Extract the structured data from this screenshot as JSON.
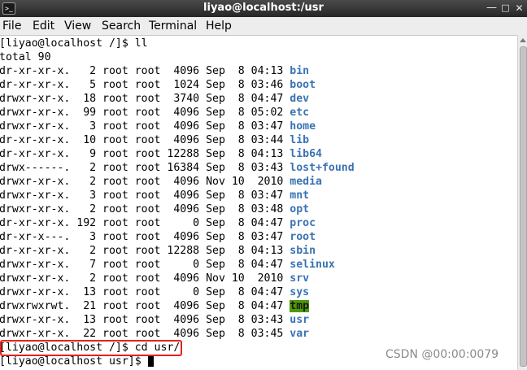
{
  "window": {
    "title": "liyao@localhost:/usr",
    "app_icon": "terminal-icon"
  },
  "menu": [
    "File",
    "Edit",
    "View",
    "Search",
    "Terminal",
    "Help"
  ],
  "terminal": {
    "prompt_root": "[liyao@localhost /]$ ",
    "command_1": "ll",
    "total": "total 90",
    "entries": [
      {
        "meta": "dr-xr-xr-x.   2 root root  4096 Sep  8 04:13 ",
        "name": "bin"
      },
      {
        "meta": "dr-xr-xr-x.   5 root root  1024 Sep  8 03:46 ",
        "name": "boot"
      },
      {
        "meta": "drwxr-xr-x.  18 root root  3740 Sep  8 04:47 ",
        "name": "dev"
      },
      {
        "meta": "drwxr-xr-x.  99 root root  4096 Sep  8 05:02 ",
        "name": "etc"
      },
      {
        "meta": "drwxr-xr-x.   3 root root  4096 Sep  8 03:47 ",
        "name": "home"
      },
      {
        "meta": "dr-xr-xr-x.  10 root root  4096 Sep  8 03:44 ",
        "name": "lib"
      },
      {
        "meta": "dr-xr-xr-x.   9 root root 12288 Sep  8 04:13 ",
        "name": "lib64"
      },
      {
        "meta": "drwx------.   2 root root 16384 Sep  8 03:43 ",
        "name": "lost+found"
      },
      {
        "meta": "drwxr-xr-x.   2 root root  4096 Nov 10  2010 ",
        "name": "media"
      },
      {
        "meta": "drwxr-xr-x.   3 root root  4096 Sep  8 03:47 ",
        "name": "mnt"
      },
      {
        "meta": "drwxr-xr-x.   2 root root  4096 Sep  8 03:48 ",
        "name": "opt"
      },
      {
        "meta": "dr-xr-xr-x. 192 root root     0 Sep  8 04:47 ",
        "name": "proc"
      },
      {
        "meta": "dr-xr-x---.   3 root root  4096 Sep  8 03:47 ",
        "name": "root"
      },
      {
        "meta": "dr-xr-xr-x.   2 root root 12288 Sep  8 04:13 ",
        "name": "sbin"
      },
      {
        "meta": "drwxr-xr-x.   7 root root     0 Sep  8 04:47 ",
        "name": "selinux"
      },
      {
        "meta": "drwxr-xr-x.   2 root root  4096 Nov 10  2010 ",
        "name": "srv"
      },
      {
        "meta": "drwxr-xr-x.  13 root root     0 Sep  8 04:47 ",
        "name": "sys"
      },
      {
        "meta": "drwxrwxrwt.  21 root root  4096 Sep  8 04:47 ",
        "name": "tmp",
        "highlight": true
      },
      {
        "meta": "drwxr-xr-x.  13 root root  4096 Sep  8 03:43 ",
        "name": "usr"
      },
      {
        "meta": "drwxr-xr-x.  22 root root  4096 Sep  8 03:45 ",
        "name": "var"
      }
    ],
    "command_2": "cd usr/",
    "prompt_usr": "[liyao@localhost usr]$ "
  },
  "watermark": "CSDN @00:00:0079",
  "colors": {
    "directory": "#3a73b3",
    "sticky_highlight": "#4e9a06",
    "annotation_box": "#e8201e"
  }
}
